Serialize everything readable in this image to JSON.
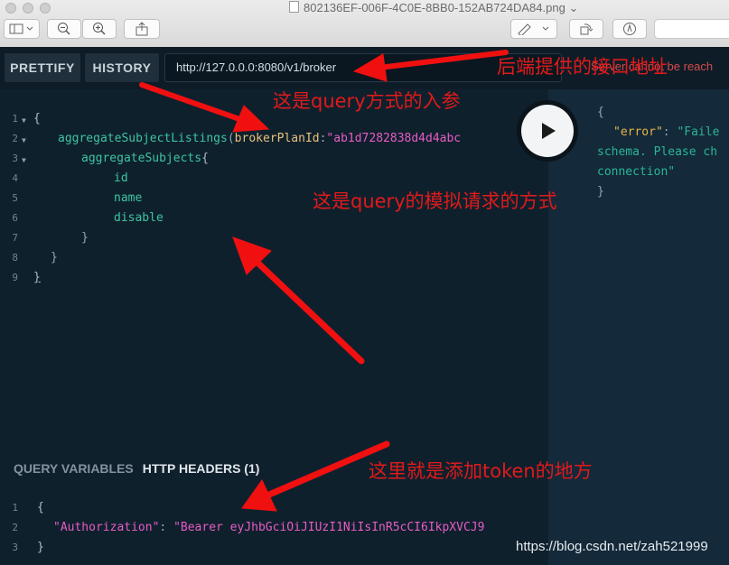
{
  "window": {
    "title": "802136EF-006F-4C0E-8BB0-152AB724DA84.png",
    "title_chevron": "⌄"
  },
  "toolbar": {
    "prettify_label": "PRETTIFY",
    "history_label": "HISTORY",
    "endpoint_url": "http://127.0.0.0:8080/v1/broker",
    "server_message": "Server cannot be reach"
  },
  "editor": {
    "line_numbers": [
      "1",
      "2",
      "3",
      "4",
      "5",
      "6",
      "7",
      "8",
      "9"
    ],
    "code": {
      "open_brace": "{",
      "field": "aggregateSubjectListings",
      "paren_open": "(",
      "arg_name": "brokerPlanId",
      "colon": ":",
      "arg_value": "\"ab1d7282838d4d4abc",
      "nested_field": "aggregateSubjects",
      "nested_brace": "{",
      "sub_fields": [
        "id",
        "name",
        "disable"
      ],
      "close_inner": "}",
      "close_mid": "}",
      "close_outer": "}"
    }
  },
  "result": {
    "open": "{",
    "key": "\"error\"",
    "colon": ":",
    "value_line1": "\"Faile",
    "value_line2": "schema. Please ch",
    "value_line3": "connection\"",
    "close": "}"
  },
  "variables": {
    "tab_query_variables": "QUERY VARIABLES",
    "tab_http_headers": "HTTP HEADERS (1)",
    "line_numbers": [
      "1",
      "2",
      "3"
    ],
    "open": "{",
    "header_key": "\"Authorization\"",
    "colon": ":",
    "header_value": "\"Bearer eyJhbGciOiJIUzI1NiIsInR5cCI6IkpXVCJ9",
    "close": "}"
  },
  "annotations": {
    "backend_url": "后端提供的接口地址",
    "query_params": "这是query方式的入参",
    "query_mock": "这是query的模拟请求的方式",
    "add_token": "这里就是添加token的地方"
  },
  "watermark": "https://blog.csdn.net/zah521999",
  "colors": {
    "annotation": "#e01a1a",
    "editor_bg": "#0f202d",
    "result_bg": "#14293a",
    "field": "#3dc5a0",
    "argument": "#e8c27a",
    "string": "#e65cc4"
  }
}
